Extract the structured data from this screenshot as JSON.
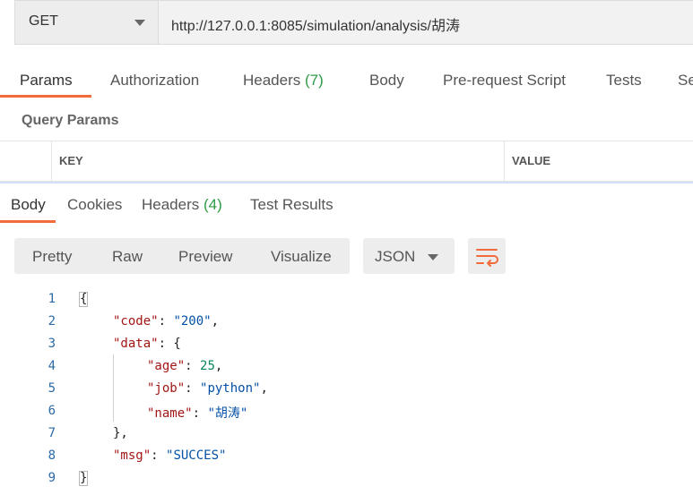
{
  "request": {
    "method": "GET",
    "url": "http://127.0.0.1:8085/simulation/analysis/胡涛"
  },
  "request_tabs": [
    {
      "label": "Params"
    },
    {
      "label": "Authorization"
    },
    {
      "label": "Headers",
      "count": "(7)"
    },
    {
      "label": "Body"
    },
    {
      "label": "Pre-request Script"
    },
    {
      "label": "Tests"
    },
    {
      "label": "Se"
    }
  ],
  "query_params": {
    "title": "Query Params",
    "columns": [
      "KEY",
      "VALUE"
    ]
  },
  "response_tabs": [
    {
      "label": "Body"
    },
    {
      "label": "Cookies"
    },
    {
      "label": "Headers",
      "count": "(4)"
    },
    {
      "label": "Test Results"
    }
  ],
  "view_modes": [
    "Pretty",
    "Raw",
    "Preview",
    "Visualize"
  ],
  "format": "JSON",
  "accent_color": "#f26b3a",
  "code": {
    "line_numbers": [
      "1",
      "2",
      "3",
      "4",
      "5",
      "6",
      "7",
      "8",
      "9"
    ],
    "code_key": "\"code\"",
    "code_val": "\"200\"",
    "data_key": "\"data\"",
    "age_key": "\"age\"",
    "age_val": "25",
    "job_key": "\"job\"",
    "job_val": "\"python\"",
    "name_key": "\"name\"",
    "name_val": "\"胡涛\"",
    "msg_key": "\"msg\"",
    "msg_val": "\"SUCCES\""
  }
}
